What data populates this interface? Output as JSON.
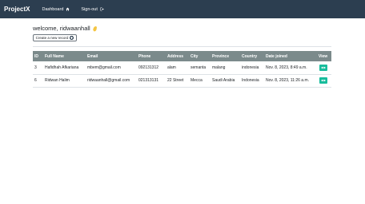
{
  "navbar": {
    "brand": "ProjectX",
    "links": [
      {
        "label": "Dashboard",
        "icon": "home-icon"
      },
      {
        "label": "Sign-out",
        "icon": "sign-out-icon"
      }
    ],
    "bg_color": "#2c3e50"
  },
  "main": {
    "welcome": "welcome, ridwaanhall",
    "create_button": "Create a new record",
    "table": {
      "headers": [
        "ID",
        "Full Name",
        "Email",
        "Phone",
        "Address",
        "City",
        "Province",
        "Country",
        "Date joined",
        "View"
      ],
      "rows": [
        {
          "id": "3",
          "full_name": "Hafidhah Afkariana",
          "email": "mbem@gmail.com",
          "phone": "092131312",
          "address": "alam",
          "city": "semanta",
          "province": "malang",
          "country": "indonesia",
          "date_joined": "Nov. 8, 2023, 8:49 a.m."
        },
        {
          "id": "6",
          "full_name": "Ridwan Halim",
          "email": "ridwaanhall@gmail.com",
          "phone": "021313131",
          "address": "22 Street",
          "city": "Mecca",
          "province": "Saudi Arabia",
          "country": "Indonesia",
          "date_joined": "Nov. 8, 2023, 11:26 a.m."
        }
      ],
      "header_color": "#7b8a8b",
      "view_button_color": "#18bc9c"
    }
  }
}
